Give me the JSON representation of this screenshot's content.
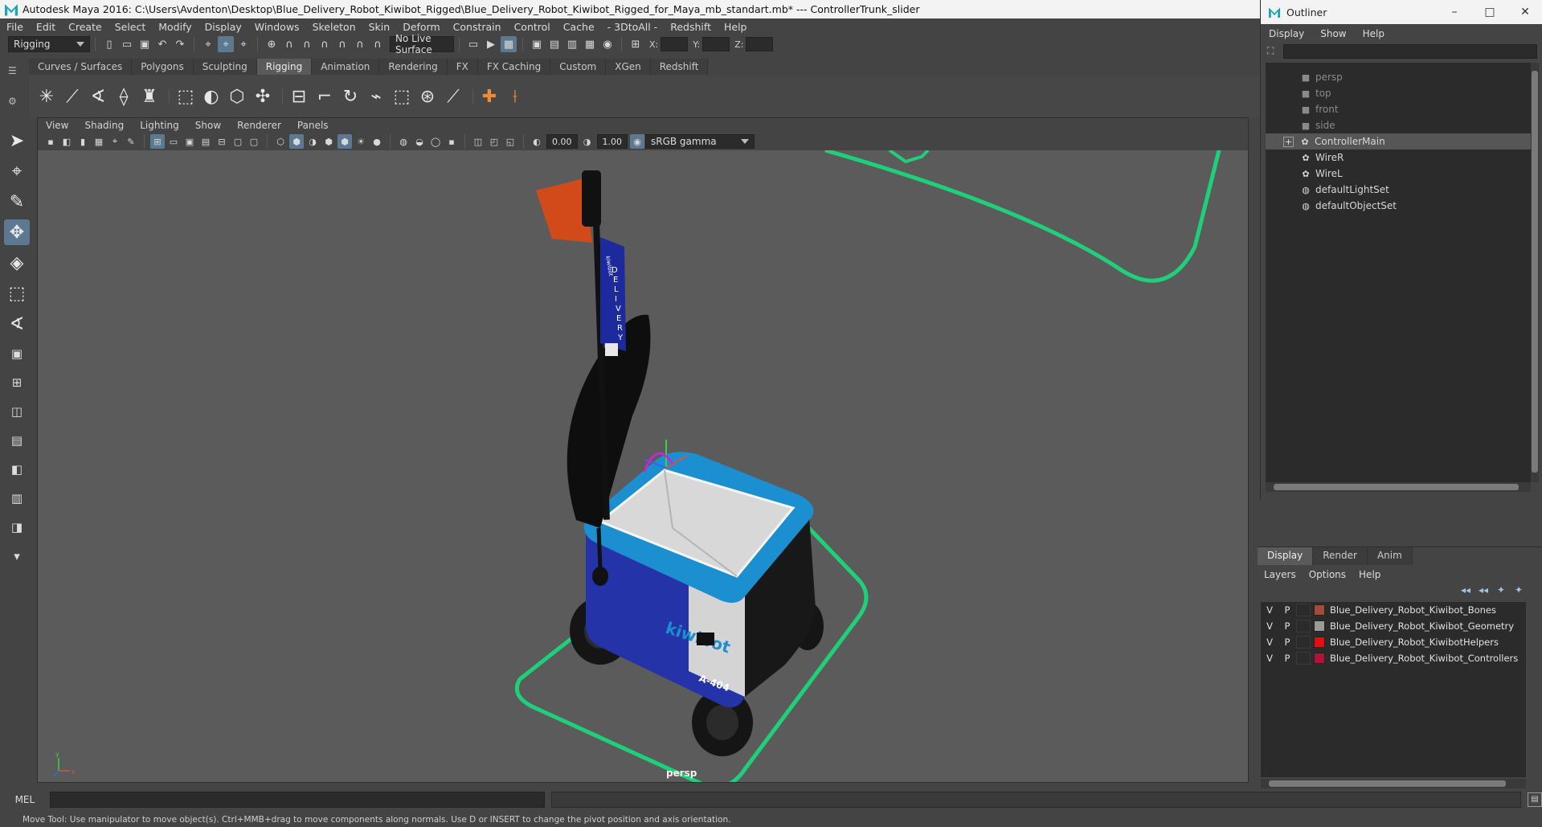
{
  "window": {
    "title": "Autodesk Maya 2016: C:\\Users\\Avdenton\\Desktop\\Blue_Delivery_Robot_Kiwibot_Rigged\\Blue_Delivery_Robot_Kiwibot_Rigged_for_Maya_mb_standart.mb*   ---   ControllerTrunk_slider"
  },
  "menu": [
    "File",
    "Edit",
    "Create",
    "Select",
    "Modify",
    "Display",
    "Windows",
    "Skeleton",
    "Skin",
    "Deform",
    "Constrain",
    "Control",
    "Cache",
    "- 3DtoAll -",
    "Redshift",
    "Help"
  ],
  "status_line": {
    "mode": "Rigging",
    "live_surface": "No Live Surface",
    "coords": {
      "x_label": "X:",
      "y_label": "Y:",
      "z_label": "Z:"
    }
  },
  "shelf_tabs": [
    "Curves / Surfaces",
    "Polygons",
    "Sculpting",
    "Rigging",
    "Animation",
    "Rendering",
    "FX",
    "FX Caching",
    "Custom",
    "XGen",
    "Redshift"
  ],
  "active_shelf": "Rigging",
  "viewport": {
    "menu": [
      "View",
      "Shading",
      "Lighting",
      "Show",
      "Renderer",
      "Panels"
    ],
    "exposure": "0.00",
    "gamma": "1.00",
    "color_space": "sRGB gamma",
    "camera": "persp",
    "scene_text": {
      "brand_top": "kiwibot",
      "sign_letters": [
        "D",
        "E",
        "L",
        "I",
        "V",
        "E",
        "R",
        "Y"
      ],
      "brand_side": "kiwibot",
      "unit_id": "A-404"
    },
    "axis": {
      "x": "x",
      "y": "y"
    }
  },
  "outliner": {
    "title": "Outliner",
    "menu": [
      "Display",
      "Show",
      "Help"
    ],
    "items": [
      {
        "name": "persp",
        "type": "camera",
        "dim": true
      },
      {
        "name": "top",
        "type": "camera",
        "dim": true
      },
      {
        "name": "front",
        "type": "camera",
        "dim": true
      },
      {
        "name": "side",
        "type": "camera",
        "dim": true
      },
      {
        "name": "ControllerMain",
        "type": "curve",
        "selected": true,
        "expandable": true
      },
      {
        "name": "WireR",
        "type": "curve"
      },
      {
        "name": "WireL",
        "type": "curve"
      },
      {
        "name": "defaultLightSet",
        "type": "set"
      },
      {
        "name": "defaultObjectSet",
        "type": "set"
      }
    ]
  },
  "layer_editor": {
    "tabs": [
      "Display",
      "Render",
      "Anim"
    ],
    "menu": [
      "Layers",
      "Options",
      "Help"
    ],
    "layers": [
      {
        "v": "V",
        "p": "P",
        "name": "Blue_Delivery_Robot_Kiwibot_Bones",
        "color": "#a34b3a"
      },
      {
        "v": "V",
        "p": "P",
        "name": "Blue_Delivery_Robot_Kiwibot_Geometry",
        "color": "#9a9a9a"
      },
      {
        "v": "V",
        "p": "P",
        "name": "Blue_Delivery_Robot_KiwibotHelpers",
        "color": "#e01010"
      },
      {
        "v": "V",
        "p": "P",
        "name": "Blue_Delivery_Robot_Kiwibot_Controllers",
        "color": "#b0123a"
      }
    ]
  },
  "command_line": {
    "label": "MEL"
  },
  "help_line": "Move Tool: Use manipulator to move object(s). Ctrl+MMB+drag to move components along normals. Use D or INSERT to change the pivot position and axis orientation.",
  "colors": {
    "accent": "#5d7891",
    "controller": "#1fd07a",
    "robot_blue": "#1b8fd0"
  }
}
